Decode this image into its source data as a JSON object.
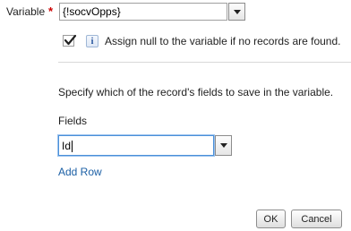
{
  "variable": {
    "label": "Variable",
    "required_marker": "*",
    "required_color": "#cc0000",
    "value": "{!socvOpps}"
  },
  "assign_null": {
    "checked": true,
    "info_icon_glyph": "i",
    "text": "Assign null to the variable if no records are found."
  },
  "fields_section": {
    "instruction": "Specify which of the record's fields to save in the variable.",
    "header": "Fields",
    "rows": [
      {
        "value": "Id"
      }
    ],
    "add_row_label": "Add Row",
    "link_color": "#1b5fa5"
  },
  "footer": {
    "ok_label": "OK",
    "cancel_label": "Cancel"
  }
}
